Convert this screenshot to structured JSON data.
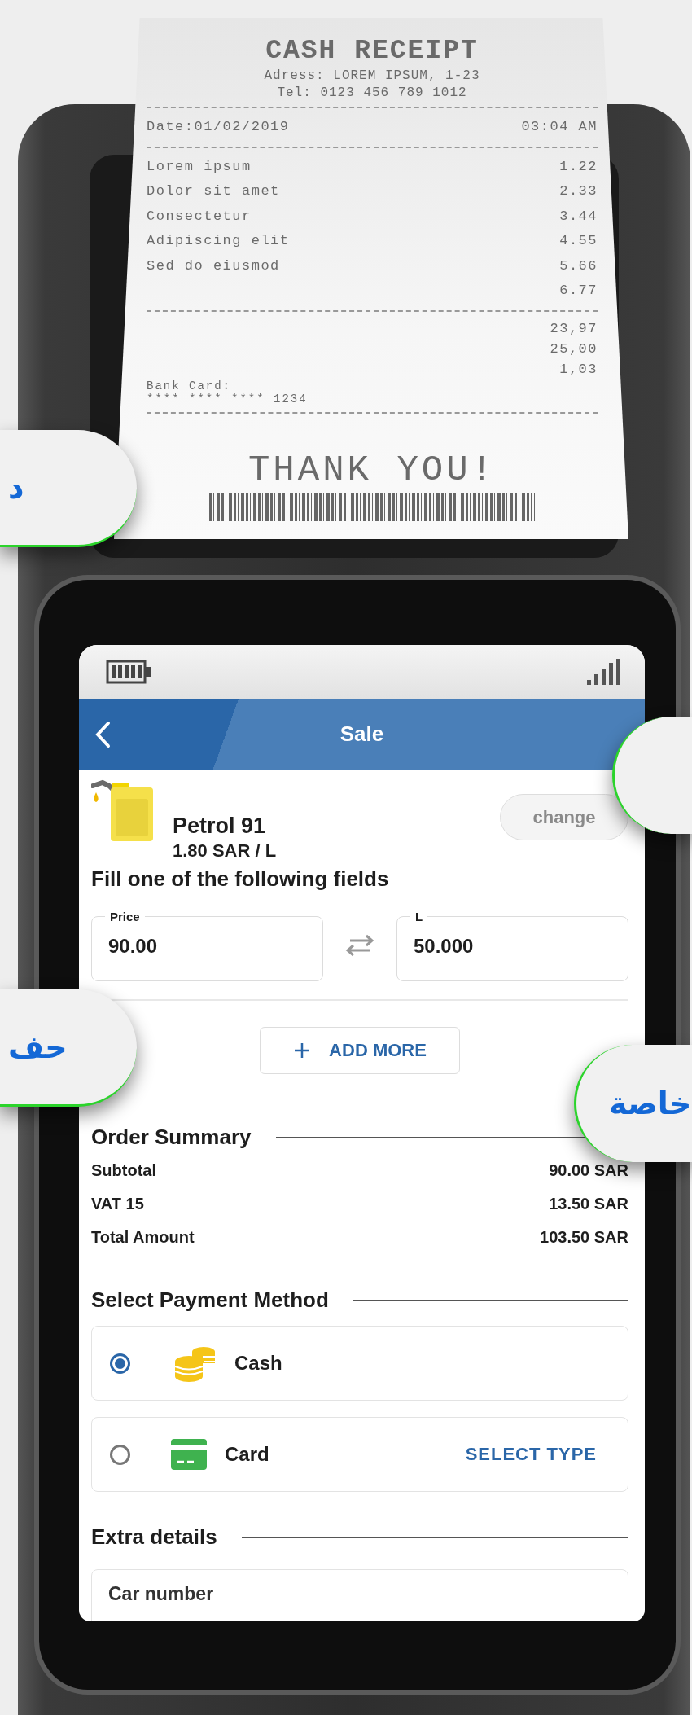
{
  "receipt": {
    "title": "CASH RECEIPT",
    "address": "Adress: LOREM IPSUM, 1-23",
    "tel": "Tel: 0123 456 789 1012",
    "date": "Date:01/02/2019",
    "time": "03:04 AM",
    "items": [
      {
        "label": "Lorem ipsum",
        "amount": "1.22"
      },
      {
        "label": "Dolor sit amet",
        "amount": "2.33"
      },
      {
        "label": "Consectetur",
        "amount": "3.44"
      },
      {
        "label": "Adipiscing elit",
        "amount": "4.55"
      },
      {
        "label": "Sed do eiusmod",
        "amount": "5.66"
      },
      {
        "amount": "6.77"
      }
    ],
    "totals": [
      "23,97",
      "25,00",
      "1,03"
    ],
    "card_label": "Bank Card:",
    "card_number": "**** **** **** 1234",
    "thanks": "THANK YOU!"
  },
  "callouts": [
    {
      "text": "د"
    },
    {
      "text": "حف"
    },
    {
      "text": "خاصة"
    }
  ],
  "app": {
    "title": "Sale",
    "product": {
      "name": "Petrol 91",
      "price": "1.80 SAR / L",
      "change_button": "change"
    },
    "fill_hint": "Fill one of the following fields",
    "fields": [
      {
        "label": "Price",
        "value": "90.00"
      },
      {
        "label": "L",
        "value": "50.000"
      }
    ],
    "add_more": "ADD MORE",
    "order_summary": {
      "heading": "Order Summary",
      "rows": [
        {
          "label": "Subtotal",
          "value": "90.00 SAR"
        },
        {
          "label": "VAT 15",
          "value": "13.50 SAR"
        },
        {
          "label": "Total Amount",
          "value": "103.50 SAR"
        }
      ]
    },
    "payment": {
      "heading": "Select Payment Method",
      "methods": [
        {
          "kind": "cash",
          "label": "Cash",
          "selected": true
        },
        {
          "kind": "card",
          "label": "Card",
          "selected": false,
          "action": "SELECT TYPE"
        }
      ]
    },
    "extra": {
      "heading": "Extra details",
      "fields": [
        {
          "label": "Car number"
        }
      ]
    }
  }
}
